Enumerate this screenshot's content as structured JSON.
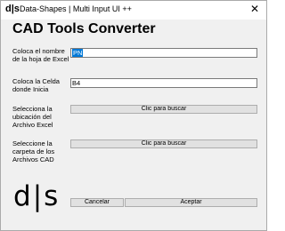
{
  "window": {
    "title": "Data-Shapes | Multi Input UI ++",
    "icon_text": "d|s",
    "close_glyph": "✕"
  },
  "main": {
    "heading": "CAD Tools Converter",
    "fields": [
      {
        "label": "Coloca el nombre\nde la hoja de Excel",
        "value": "PN"
      },
      {
        "label": "Coloca la Celda\ndonde Inicia",
        "value": "B4"
      }
    ],
    "browse": [
      {
        "label": "Selecciona la\nubicación del\nArchivo Excel",
        "button": "Clic para buscar"
      },
      {
        "label": "Seleccione la\ncarpeta de los\nArchivos CAD",
        "button": "Clic para buscar"
      }
    ],
    "logo": {
      "left": "d",
      "right": "s"
    },
    "actions": {
      "cancel": "Cancelar",
      "accept": "Aceptar"
    }
  },
  "colors": {
    "selection": "#0078d7",
    "button_bg": "#e1e1e1",
    "window_bg": "#f0f0f0"
  }
}
